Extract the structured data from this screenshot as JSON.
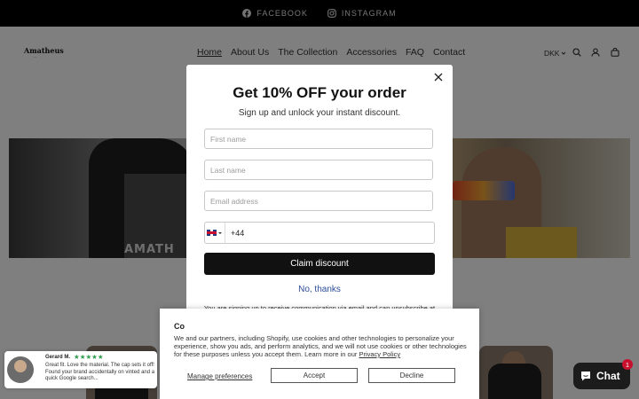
{
  "topbar": {
    "links": [
      {
        "label": "FACEBOOK",
        "icon": "facebook-icon"
      },
      {
        "label": "INSTAGRAM",
        "icon": "instagram-icon"
      }
    ]
  },
  "header": {
    "logo": "Amatheus",
    "nav": [
      "Home",
      "About Us",
      "The Collection",
      "Accessories",
      "FAQ",
      "Contact"
    ],
    "currency": "DKK",
    "icons": [
      "search-icon",
      "account-icon",
      "cart-icon"
    ]
  },
  "hero": {
    "brand_text": "AMATH"
  },
  "popup": {
    "title": "Get 10% OFF your order",
    "subtitle": "Sign up and unlock your instant discount.",
    "first_name_placeholder": "First name",
    "last_name_placeholder": "Last name",
    "email_placeholder": "Email address",
    "phone_code": "+44",
    "claim_label": "Claim discount",
    "decline_label": "No, thanks",
    "legal": "You are signing up to receive communication via email and can unsubscribe at any time."
  },
  "cookie": {
    "title": "Co",
    "text": "We and our partners, including Shopify, use cookies and other technologies to personalize your experience, show you ads, and perform analytics, and we will not use cookies or other technologies for these purposes unless you accept them. Learn more in our ",
    "policy_link": "Privacy Policy",
    "manage_label": "Manage preferences",
    "accept_label": "Accept",
    "decline_label": "Decline"
  },
  "review": {
    "name": "Gerard M.",
    "stars": "★★★★★",
    "text": "Great fit. Love the material. The cap sets it off! Found your brand accidentally on vinted and a quick Google search..."
  },
  "chat": {
    "label": "Chat",
    "badge": "1"
  },
  "colors": {
    "topbar": "#000000",
    "button": "#111111",
    "link": "#2b4c9a",
    "stars": "#2e9e4f",
    "badge": "#c8102e"
  }
}
